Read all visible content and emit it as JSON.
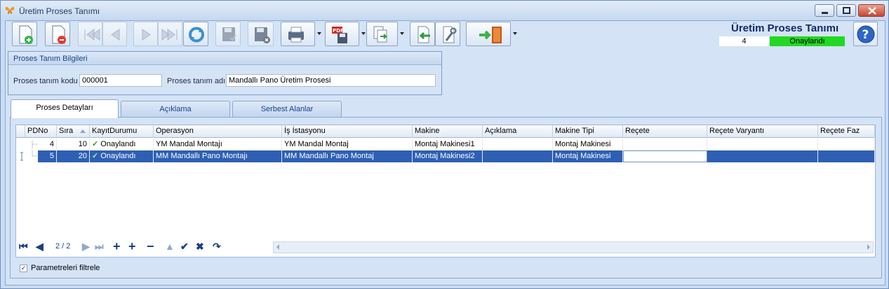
{
  "window": {
    "title": "Üretim Proses Tanımı"
  },
  "header": {
    "form_title": "Üretim Proses Tanımı",
    "record_no": "4",
    "status_label": "Onaylandı",
    "status_color": "#22d822"
  },
  "toolbar": {
    "icons": [
      "new-document-icon",
      "delete-document-icon",
      "first-record-icon",
      "prev-record-icon",
      "next-record-icon",
      "last-record-icon",
      "refresh-icon",
      "save-icon",
      "save-close-icon",
      "print-icon",
      "pdf-icon",
      "export-icon",
      "import-icon",
      "settings-icon",
      "exit-icon",
      "help-icon"
    ]
  },
  "info_group": {
    "title": "Proses Tanım Bilgileri",
    "code_label": "Proses tanım kodu",
    "code_value": "000001",
    "name_label": "Proses tanım adı",
    "name_value": "Mandallı Pano Üretim Prosesi"
  },
  "tabs": [
    {
      "label": "Proses Detayları"
    },
    {
      "label": "Açıklama"
    },
    {
      "label": "Serbest Alanlar"
    }
  ],
  "grid": {
    "columns": [
      "PDNo",
      "Sıra",
      "KayıtDurumu",
      "Operasyon",
      "İş İstasyonu",
      "Makine",
      "Açıklama",
      "Makine Tipi",
      "Reçete",
      "Reçete Varyantı",
      "Reçete Faz"
    ],
    "rows": [
      {
        "pdno": "4",
        "sira": "10",
        "durum": "Onaylandı",
        "operasyon": "YM Mandal Montajı",
        "istasyon": "YM Mandal Montaj",
        "makine": "Montaj Makinesi1",
        "aciklama": "",
        "makine_tipi": "Montaj Makinesi",
        "recete": "",
        "varyant": "",
        "faz": ""
      },
      {
        "pdno": "5",
        "sira": "20",
        "durum": "Onaylandı",
        "operasyon": "MM Mandallı Pano Montajı",
        "istasyon": "MM Mandallı Pano Montaj",
        "makine": "Montaj Makinesi2",
        "aciklama": "",
        "makine_tipi": "Montaj Makinesi",
        "recete": "",
        "varyant": "",
        "faz": ""
      }
    ],
    "selected_row": 2
  },
  "navigator": {
    "position_text": "2 / 2"
  },
  "filter": {
    "label": "Parametreleri filtrele",
    "checked": true
  }
}
